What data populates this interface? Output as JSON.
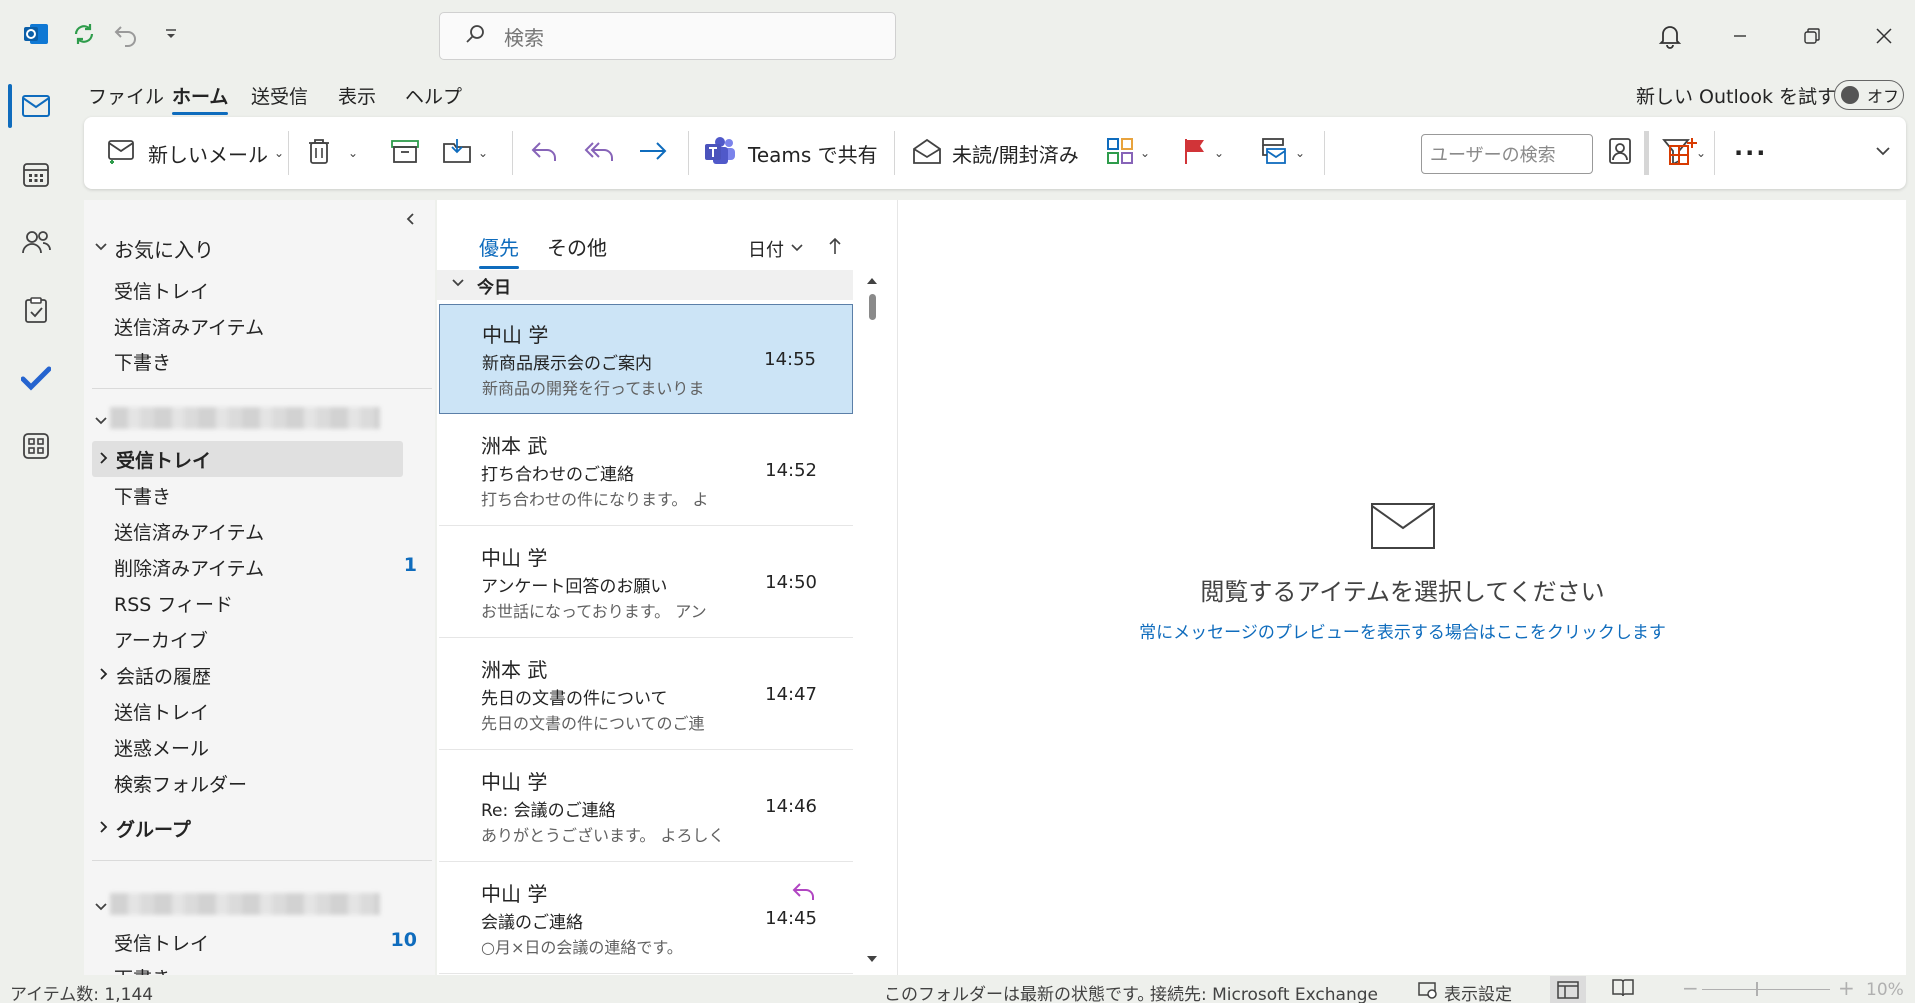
{
  "titlebar": {
    "search_placeholder": "検索"
  },
  "menu": {
    "tabs": [
      "ファイル",
      "ホーム",
      "送受信",
      "表示",
      "ヘルプ"
    ],
    "try_new": "新しい Outlook を試す",
    "toggle_label": "オフ"
  },
  "ribbon": {
    "new_mail": "新しいメール",
    "teams_share": "Teams で共有",
    "read_unread": "未読/開封済み",
    "people_search_placeholder": "ユーザーの検索"
  },
  "folders": {
    "favorites_title": "お気に入り",
    "favorites": [
      "受信トレイ",
      "送信済みアイテム",
      "下書き"
    ],
    "account1": [
      {
        "label": "受信トレイ",
        "count": ""
      },
      {
        "label": "下書き",
        "count": ""
      },
      {
        "label": "送信済みアイテム",
        "count": ""
      },
      {
        "label": "削除済みアイテム",
        "count": "1"
      },
      {
        "label": "RSS フィード",
        "count": ""
      },
      {
        "label": "アーカイブ",
        "count": ""
      },
      {
        "label": "会話の履歴",
        "count": ""
      },
      {
        "label": "送信トレイ",
        "count": ""
      },
      {
        "label": "迷惑メール",
        "count": ""
      },
      {
        "label": "検索フォルダー",
        "count": ""
      }
    ],
    "groups": "グループ",
    "account2": [
      {
        "label": "受信トレイ",
        "count": "10"
      },
      {
        "label": "下書き",
        "count": ""
      }
    ]
  },
  "message_list": {
    "tab_focused": "優先",
    "tab_other": "その他",
    "sort_label": "日付",
    "group_today": "今日",
    "mails": [
      {
        "from": "中山 学",
        "subject": "新商品展示会のご案内",
        "time": "14:55",
        "preview": "新商品の開発を行ってまいりま"
      },
      {
        "from": "洲本 武",
        "subject": "打ち合わせのご連絡",
        "time": "14:52",
        "preview": "打ち合わせの件になります。 よ"
      },
      {
        "from": "中山 学",
        "subject": "アンケート回答のお願い",
        "time": "14:50",
        "preview": "お世話になっております。 アン"
      },
      {
        "from": "洲本 武",
        "subject": "先日の文書の件について",
        "time": "14:47",
        "preview": "先日の文書の件についてのご連"
      },
      {
        "from": "中山 学",
        "subject": "Re: 会議のご連絡",
        "time": "14:46",
        "preview": "ありがとうございます。 よろしく"
      },
      {
        "from": "中山 学",
        "subject": "会議のご連絡",
        "time": "14:45",
        "preview": "○月×日の会議の連絡です。"
      }
    ]
  },
  "reading_pane": {
    "empty_text": "閲覧するアイテムを選択してください",
    "preview_link": "常にメッセージのプレビューを表示する場合はここをクリックします"
  },
  "status_bar": {
    "item_count": "アイテム数: 1,144",
    "folder_status": "このフォルダーは最新の状態です。",
    "connection": "接続先: Microsoft Exchange",
    "display_settings": "表示設定",
    "zoom": "10%"
  },
  "colors": {
    "accent": "#0f6cbd",
    "selected_mail": "#cce4f6",
    "flag": "#d13438",
    "reply_purple": "#b146c2"
  }
}
